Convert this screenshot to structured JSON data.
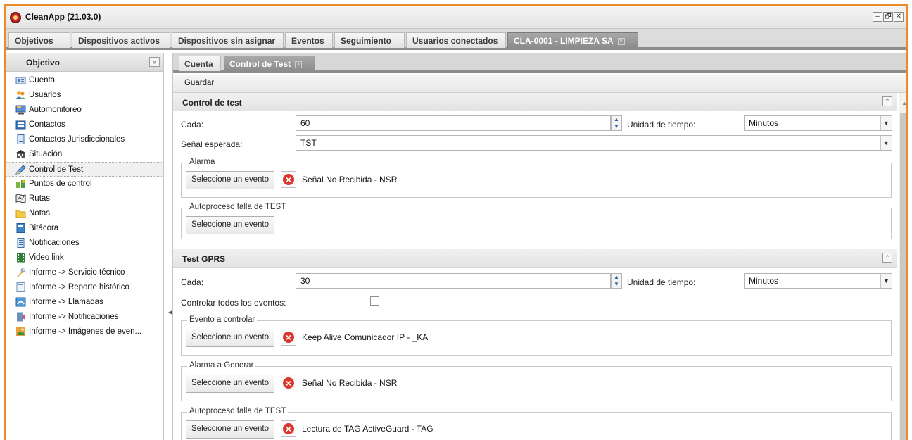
{
  "window": {
    "title": "CleanApp (21.03.0)",
    "controls": [
      "–",
      "🗗",
      "✕"
    ]
  },
  "top_tabs": [
    {
      "label": "Objetivos"
    },
    {
      "label": "Dispositivos activos"
    },
    {
      "label": "Dispositivos sin asignar"
    },
    {
      "label": "Eventos"
    },
    {
      "label": "Seguimiento"
    },
    {
      "label": "Usuarios conectados"
    },
    {
      "label": "CLA-0001 - LIMPIEZA SA",
      "active": true,
      "closable": true
    }
  ],
  "sidebar": {
    "title": "Objetivo",
    "collapse_glyph": "«",
    "items": [
      {
        "label": "Cuenta",
        "icon": "account-card-icon"
      },
      {
        "label": "Usuarios",
        "icon": "users-icon"
      },
      {
        "label": "Automonitoreo",
        "icon": "monitor-icon"
      },
      {
        "label": "Contactos",
        "icon": "contacts-icon"
      },
      {
        "label": "Contactos Jurisdiccionales",
        "icon": "document-icon"
      },
      {
        "label": "Situación",
        "icon": "building-icon"
      },
      {
        "label": "Control de Test",
        "icon": "pencil-icon",
        "selected": true
      },
      {
        "label": "Puntos de control",
        "icon": "checkpoint-icon"
      },
      {
        "label": "Rutas",
        "icon": "map-icon"
      },
      {
        "label": "Notas",
        "icon": "folder-icon"
      },
      {
        "label": "Bitácora",
        "icon": "logbook-icon"
      },
      {
        "label": "Notificaciones",
        "icon": "notification-doc-icon"
      },
      {
        "label": "Video link",
        "icon": "film-icon"
      },
      {
        "label": "Informe -> Servicio técnico",
        "icon": "wrench-icon"
      },
      {
        "label": "Informe -> Reporte histórico",
        "icon": "report-icon"
      },
      {
        "label": "Informe -> Llamadas",
        "icon": "phone-report-icon"
      },
      {
        "label": "Informe -> Notificaciones",
        "icon": "notification-report-icon"
      },
      {
        "label": "Informe -> Imágenes de even...",
        "icon": "images-report-icon"
      }
    ]
  },
  "sub_tabs": [
    {
      "label": "Cuenta"
    },
    {
      "label": "Control de Test",
      "active": true,
      "closable": true
    }
  ],
  "toolbar": {
    "save_label": "Guardar"
  },
  "control_test": {
    "title": "Control de test",
    "every_label": "Cada:",
    "every_value": "60",
    "time_unit_label": "Unidad de tiempo:",
    "time_unit_value": "Minutos",
    "expected_signal_label": "Señal esperada:",
    "expected_signal_value": "TST",
    "alarm_legend": "Alarma",
    "alarm_button": "Seleccione un evento",
    "alarm_event": "Señal No Recibida - NSR",
    "autoprocess_legend": "Autoproceso falla de TEST",
    "autoprocess_button": "Seleccione un evento"
  },
  "test_gprs": {
    "title": "Test GPRS",
    "every_label": "Cada:",
    "every_value": "30",
    "time_unit_label": "Unidad de tiempo:",
    "time_unit_value": "Minutos",
    "control_all_label": "Controlar todos los eventos:",
    "control_all_checked": false,
    "event_legend": "Evento a controlar",
    "event_button": "Seleccione un evento",
    "event_value": "Keep Alive Comunicador IP - _KA",
    "alarm_legend": "Alarma a Generar",
    "alarm_button": "Seleccione un evento",
    "alarm_value": "Señal No Recibida - NSR",
    "autoprocess_legend": "Autoproceso falla de TEST",
    "autoprocess_button": "Seleccione un evento",
    "autoprocess_value": "Lectura de TAG ActiveGuard - TAG"
  },
  "colors": {
    "frame_accent": "#f0892a",
    "active_tab": "#999999",
    "remove_icon": "#d9372c"
  }
}
